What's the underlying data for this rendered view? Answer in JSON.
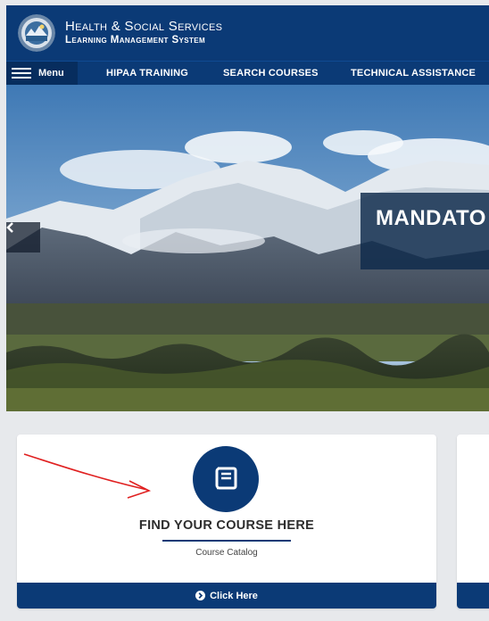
{
  "header": {
    "title_line1": "Health & Social Services",
    "title_line2": "Learning Management System"
  },
  "nav": {
    "menu_label": "Menu",
    "links": [
      "HIPAA TRAINING",
      "SEARCH COURSES",
      "TECHNICAL ASSISTANCE"
    ]
  },
  "hero": {
    "banner_text": "MANDATO"
  },
  "card": {
    "title": "FIND YOUR COURSE HERE",
    "subtitle": "Course Catalog",
    "button_label": "Click Here",
    "icon": "book-icon"
  },
  "colors": {
    "brand_navy": "#0b3a76",
    "annotation_red": "#e02020"
  }
}
